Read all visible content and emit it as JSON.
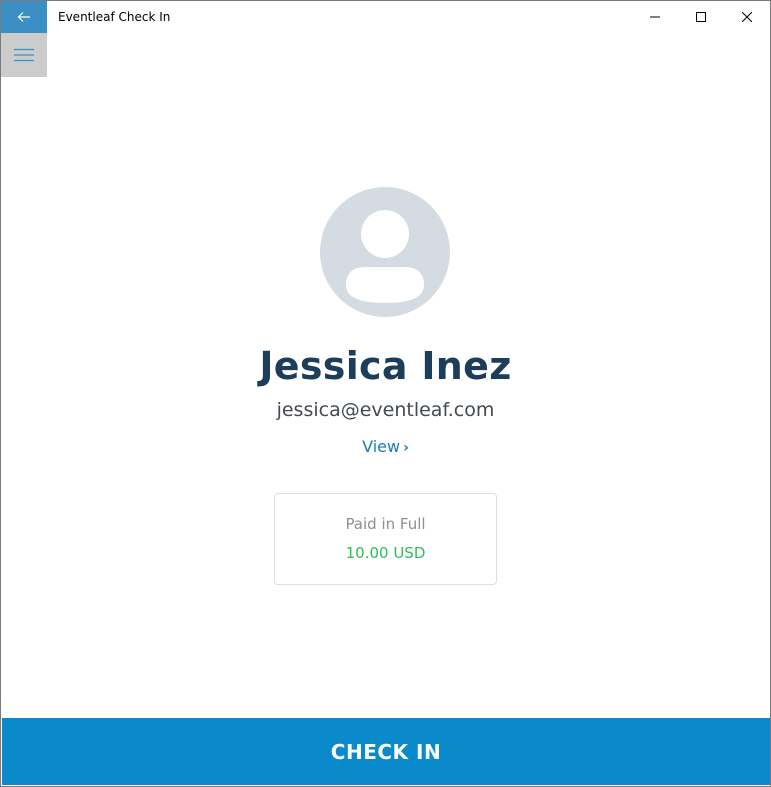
{
  "window": {
    "title": "Eventleaf Check In"
  },
  "icons": {
    "back": "back-arrow-icon",
    "menu": "hamburger-icon",
    "minimize": "minimize-icon",
    "maximize": "maximize-icon",
    "close": "close-icon",
    "avatar": "user-avatar-icon",
    "chevron": "chevron-right-icon"
  },
  "attendee": {
    "name": "Jessica Inez",
    "email": "jessica@eventleaf.com",
    "view_label": "View",
    "view_chevron": "›"
  },
  "payment": {
    "status": "Paid in Full",
    "amount": "10.00 USD"
  },
  "actions": {
    "check_in_label": "CHECK IN"
  },
  "colors": {
    "accent": "#0a8acb",
    "back_button": "#3b8fc4",
    "name": "#1d3e5a",
    "paid": "#2dbe5a",
    "avatar": "#d5dbe2"
  }
}
